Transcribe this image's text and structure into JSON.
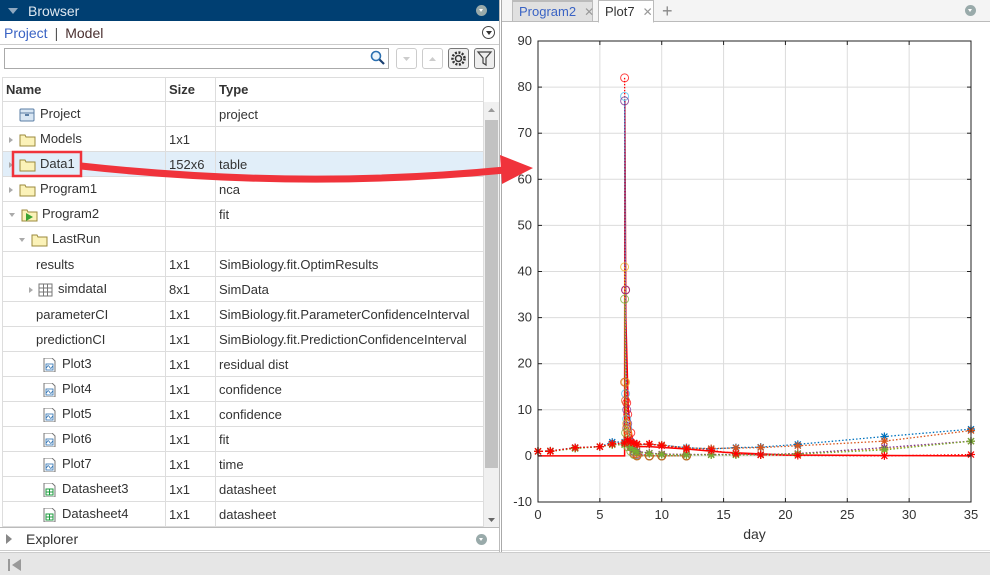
{
  "browser": {
    "title": "Browser",
    "tab_project": "Project",
    "tab_separator": "|",
    "tab_model": "Model",
    "search_value": "",
    "columns": [
      "Name",
      "Size",
      "Type"
    ],
    "rows": [
      {
        "name": "Project",
        "size": "",
        "type": "project",
        "icon": "project-icon",
        "expander": "none",
        "level": 0
      },
      {
        "name": "Models",
        "size": "1x1",
        "type": "",
        "icon": "folder-icon",
        "expander": "collapsed",
        "level": 0
      },
      {
        "name": "Data1",
        "size": "152x6",
        "type": "table",
        "icon": "folder-icon",
        "expander": "collapsed",
        "level": 0,
        "selected": true
      },
      {
        "name": "Program1",
        "size": "",
        "type": "nca",
        "icon": "folder-icon",
        "expander": "collapsed",
        "level": 0
      },
      {
        "name": "Program2",
        "size": "",
        "type": "fit",
        "icon": "program-icon",
        "expander": "expanded",
        "level": 0
      },
      {
        "name": "LastRun",
        "size": "",
        "type": "",
        "icon": "folder-icon",
        "expander": "expanded",
        "level": 1
      },
      {
        "name": "results",
        "size": "1x1",
        "type": "SimBiology.fit.OptimResults",
        "icon": "",
        "expander": "none",
        "level": 2
      },
      {
        "name": "simdataI",
        "size": "8x1",
        "type": "SimData",
        "icon": "grid-icon",
        "expander": "collapsed",
        "level": 2
      },
      {
        "name": "parameterCI",
        "size": "1x1",
        "type": "SimBiology.fit.ParameterConfidenceInterval",
        "icon": "",
        "expander": "none",
        "level": 2
      },
      {
        "name": "predictionCI",
        "size": "1x1",
        "type": "SimBiology.fit.PredictionConfidenceInterval",
        "icon": "",
        "expander": "none",
        "level": 2
      },
      {
        "name": "Plot3",
        "size": "1x1",
        "type": "residual dist",
        "icon": "plot-icon",
        "expander": "none",
        "level": 3
      },
      {
        "name": "Plot4",
        "size": "1x1",
        "type": "confidence",
        "icon": "plot-icon",
        "expander": "none",
        "level": 3
      },
      {
        "name": "Plot5",
        "size": "1x1",
        "type": "confidence",
        "icon": "plot-icon",
        "expander": "none",
        "level": 3
      },
      {
        "name": "Plot6",
        "size": "1x1",
        "type": "fit",
        "icon": "plot-icon",
        "expander": "none",
        "level": 3
      },
      {
        "name": "Plot7",
        "size": "1x1",
        "type": "time",
        "icon": "plot-icon",
        "expander": "none",
        "level": 3
      },
      {
        "name": "Datasheet3",
        "size": "1x1",
        "type": "datasheet",
        "icon": "datasheet-icon",
        "expander": "none",
        "level": 3
      },
      {
        "name": "Datasheet4",
        "size": "1x1",
        "type": "datasheet",
        "icon": "datasheet-icon",
        "expander": "none",
        "level": 3
      }
    ]
  },
  "explorer": {
    "title": "Explorer"
  },
  "doc_tabs": [
    {
      "label": "Program2",
      "active": false
    },
    {
      "label": "Plot7",
      "active": true
    }
  ],
  "colors": {
    "header": "#003f72",
    "selection": "#e1eef9",
    "annotation": "#f0333b"
  },
  "chart_data": {
    "type": "line",
    "xlabel": "day",
    "ylabel": "",
    "xlim": [
      0,
      35
    ],
    "ylim": [
      -10,
      90
    ],
    "xticks": [
      0,
      5,
      10,
      15,
      20,
      25,
      30,
      35
    ],
    "yticks": [
      -10,
      0,
      10,
      20,
      30,
      40,
      50,
      60,
      70,
      80,
      90
    ],
    "grid": true,
    "star_x": [
      0,
      1,
      3,
      5,
      6,
      7,
      7.25,
      7.5,
      7.75,
      8,
      9,
      10,
      12,
      14,
      16,
      18,
      21,
      28,
      35
    ],
    "star_series": [
      {
        "color": "#0072BD",
        "values": [
          1,
          1.1,
          1.8,
          2,
          3,
          3,
          3.5,
          2.8,
          2.6,
          2.5,
          2.5,
          2.3,
          1.8,
          1.5,
          1.8,
          1.9,
          2.5,
          4.2,
          5.8
        ]
      },
      {
        "color": "#D95319",
        "values": [
          1,
          1.1,
          1.7,
          2,
          2.6,
          2.8,
          3.2,
          2.7,
          2.5,
          2.4,
          2.5,
          2.4,
          1.7,
          1.6,
          1.7,
          1.8,
          2.2,
          3.2,
          5.5
        ]
      },
      {
        "color": "#EDB120",
        "values": [
          1,
          1,
          1.7,
          2,
          2.5,
          2.6,
          3,
          2.2,
          1.5,
          1,
          0.6,
          0.4,
          0.3,
          0.3,
          0.3,
          0.3,
          0.5,
          1.5,
          3.2
        ]
      },
      {
        "color": "#7E2F8E",
        "values": [
          1,
          1,
          1.7,
          2,
          2.5,
          2.5,
          3,
          2,
          1.4,
          1,
          0.6,
          0.4,
          0.3,
          0.3,
          0.3,
          0.3,
          0.5,
          1.8,
          3.2
        ]
      },
      {
        "color": "#77AC30",
        "values": [
          1,
          1,
          1.6,
          2,
          2.4,
          2.4,
          2.8,
          1.8,
          1.2,
          0.8,
          0.5,
          0.3,
          0.2,
          0.2,
          0.2,
          0.2,
          0.4,
          1.3,
          3.2
        ]
      },
      {
        "color": "#FF0000",
        "values": [
          1,
          1,
          1.8,
          2,
          2.6,
          2.8,
          3.5,
          3,
          2.8,
          2.6,
          2.6,
          2.2,
          1.5,
          1.2,
          0.5,
          0.2,
          0.1,
          0,
          0.3
        ]
      }
    ],
    "circle_x": [
      7,
      7.08,
      7.17,
      7.25,
      7.5,
      7.75,
      8,
      9,
      10,
      12
    ],
    "circle_series": [
      {
        "color": "#FF0000",
        "values": [
          82,
          36,
          11.5,
          9,
          5,
          2,
          0.5,
          0,
          0,
          0
        ]
      },
      {
        "color": "#4DBEEE",
        "values": [
          78,
          13.5,
          8,
          6,
          3,
          1,
          0.3,
          0,
          0,
          0
        ]
      },
      {
        "color": "#7E2F8E",
        "values": [
          77,
          36,
          10,
          7,
          3,
          1,
          0.2,
          0,
          0,
          0
        ]
      },
      {
        "color": "#EDB120",
        "values": [
          41,
          16,
          7,
          5,
          2,
          0.5,
          0.1,
          0,
          0,
          0
        ]
      },
      {
        "color": "#77AC30",
        "values": [
          34,
          5,
          3,
          2,
          1,
          0.3,
          0,
          0,
          0,
          0
        ]
      },
      {
        "color": "#D95319",
        "values": [
          16,
          12,
          6,
          4,
          2,
          0.5,
          0,
          0,
          0,
          0
        ]
      }
    ],
    "fit_line": {
      "color": "#FF0000",
      "x": [
        0,
        7,
        7.02,
        7.1,
        7.3,
        7.6,
        8,
        9,
        12,
        15,
        20,
        35
      ],
      "values": [
        0,
        0,
        77,
        30,
        10,
        4,
        2,
        2,
        1.5,
        0.8,
        0.2,
        0
      ]
    }
  }
}
